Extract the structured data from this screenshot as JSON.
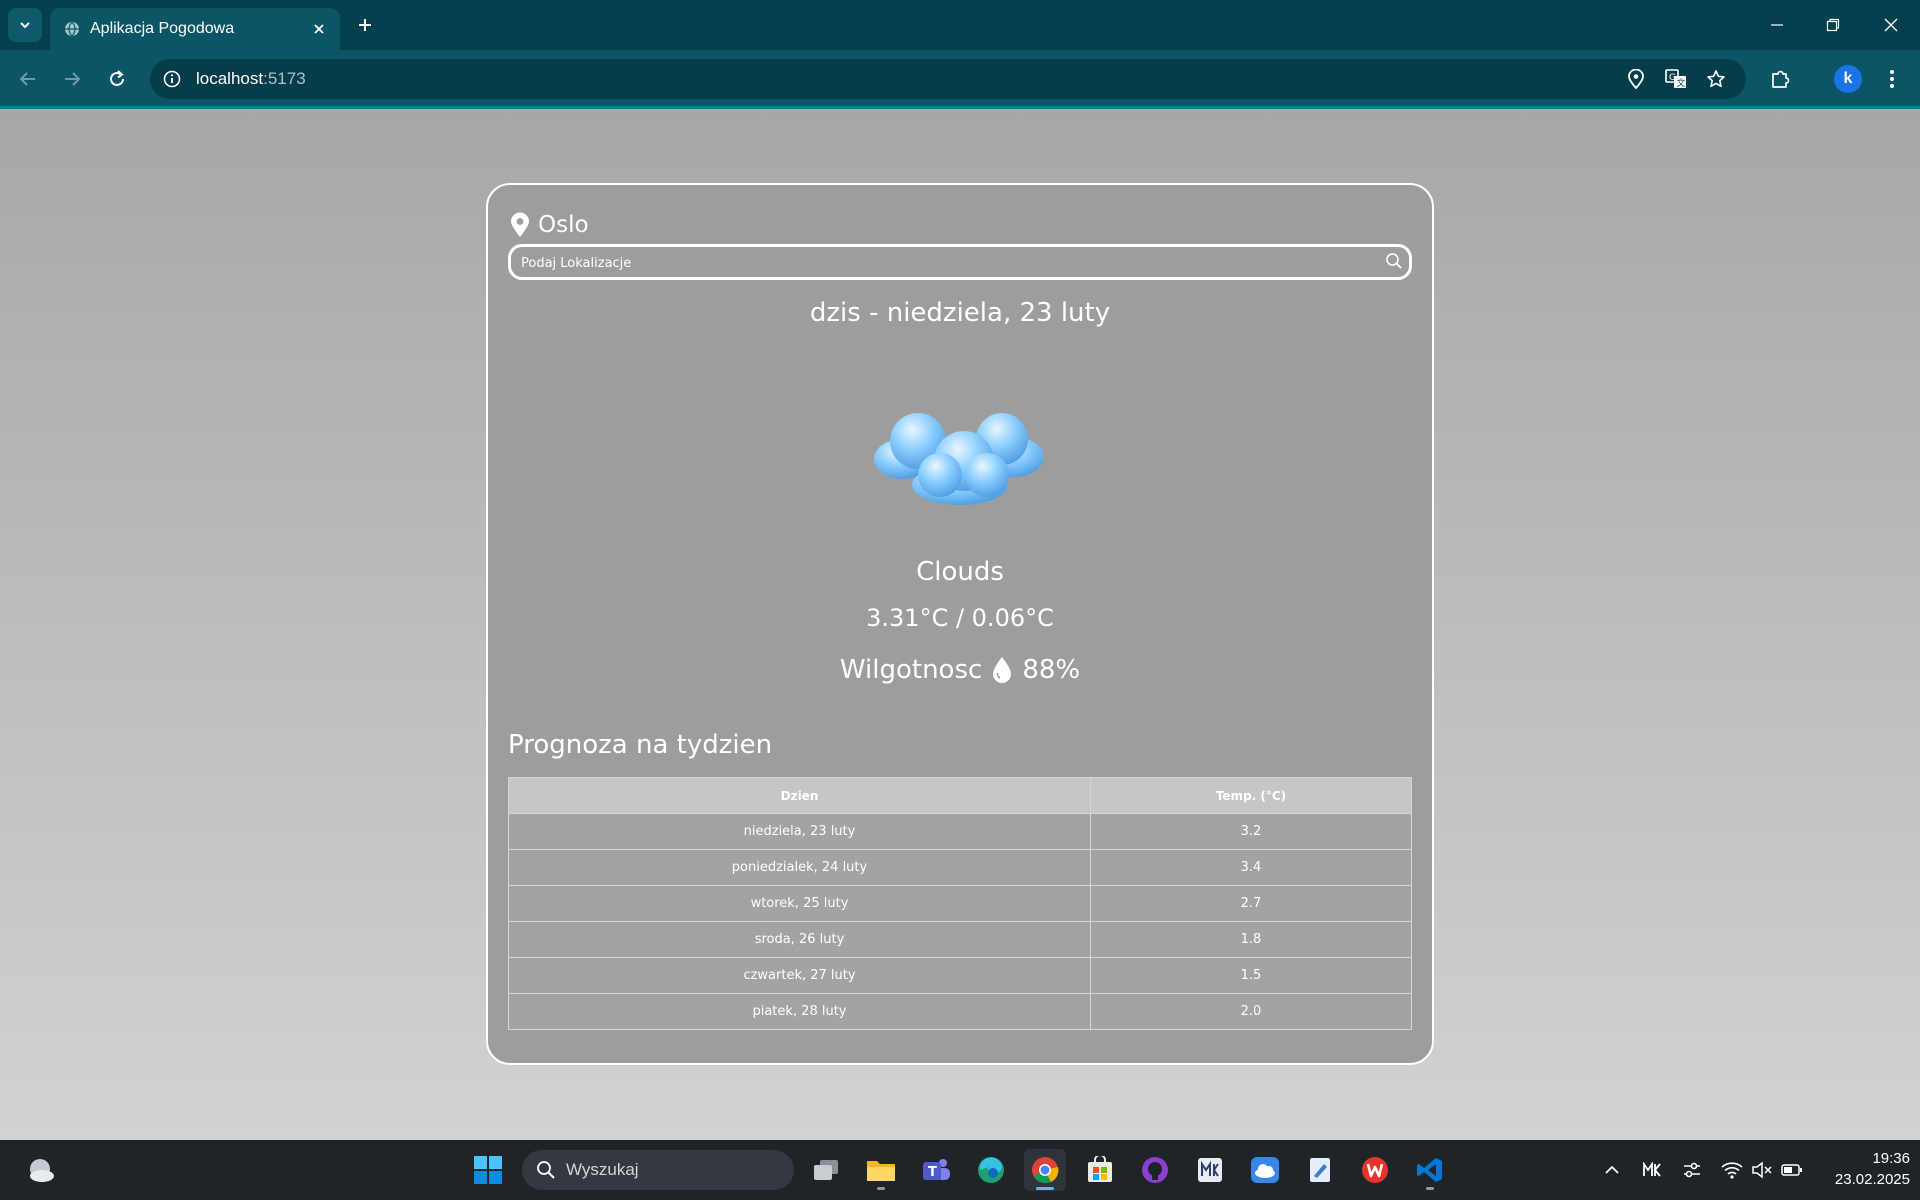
{
  "browser": {
    "tab_title": "Aplikacja Pogodowa",
    "url_host": "localhost",
    "url_port": ":5173",
    "profile_initial": "k"
  },
  "weather": {
    "city": "Oslo",
    "search_placeholder": "Podaj Lokalizacje",
    "date_title": "dzis - niedziela, 23 luty",
    "condition": "Clouds",
    "temps": "3.31°C / 0.06°C",
    "humidity_label": "Wilgotnosc",
    "humidity_value": "88%",
    "forecast_title": "Prognoza na tydzien",
    "forecast_headers": [
      "Dzien",
      "Temp. (°C)"
    ],
    "forecast_rows": [
      {
        "day": "niedziela, 23 luty",
        "temp": "3.2"
      },
      {
        "day": "poniedzialek, 24 luty",
        "temp": "3.4"
      },
      {
        "day": "wtorek, 25 luty",
        "temp": "2.7"
      },
      {
        "day": "sroda, 26 luty",
        "temp": "1.8"
      },
      {
        "day": "czwartek, 27 luty",
        "temp": "1.5"
      },
      {
        "day": "piatek, 28 luty",
        "temp": "2.0"
      }
    ]
  },
  "taskbar": {
    "search_label": "Wyszukaj",
    "time": "19:36",
    "date": "23.02.2025"
  },
  "colors": {
    "chrome_tabbar": "#05404f",
    "chrome_toolbar": "#0b5566",
    "card_background": "#9d9d9d",
    "taskbar": "#1f2429"
  }
}
